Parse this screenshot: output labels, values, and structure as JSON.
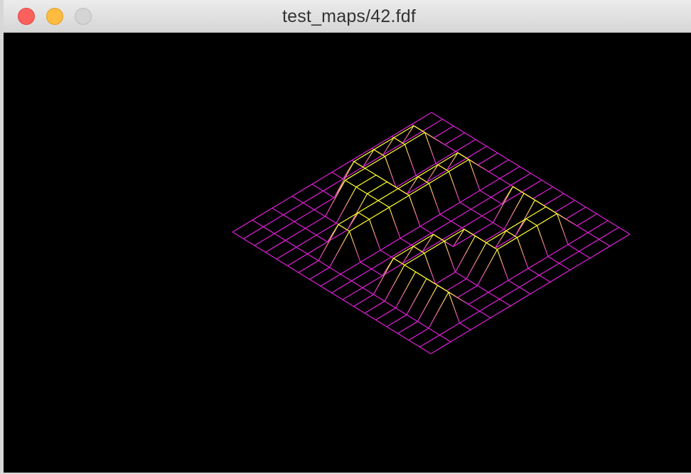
{
  "window": {
    "title": "test_maps/42.fdf",
    "controls": {
      "close": "close-button",
      "minimize": "minimize-button",
      "zoom": "zoom-button"
    }
  },
  "render": {
    "background": "#000000",
    "low_color": "#e020d8",
    "high_color": "#ffff30",
    "projection": "isometric wireframe",
    "map": [
      "0 0 0 0 0 0 0 0 0 0 0 0 0 0 0 0 0 0 0",
      "0 0 0 0 0 0 0 0 0 0 0 0 0 0 0 0 0 0 0",
      "0 0 10 10 0 0 10 10 0 0 0 10 10 10 10 10 0 0 0",
      "0 0 10 10 0 0 10 10 0 0 0 0 0 0 10 10 0 0 0",
      "0 0 10 10 0 0 10 10 0 0 0 0 0 0 10 10 0 0 0",
      "0 0 10 10 10 10 10 10 0 0 0 0 10 10 10 10 0 0 0",
      "0 0 0 10 10 10 10 10 0 0 0 10 10 0 0 0 0 0 0",
      "0 0 0 0 0 0 10 10 0 0 0 10 10 0 0 0 0 0 0",
      "0 0 0 0 0 0 10 10 0 0 0 10 10 10 10 10 10 0 0",
      "0 0 0 0 0 0 0 0 0 0 0 0 0 0 0 0 0 0 0",
      "0 0 0 0 0 0 0 0 0 0 0 0 0 0 0 0 0 0 0"
    ]
  }
}
